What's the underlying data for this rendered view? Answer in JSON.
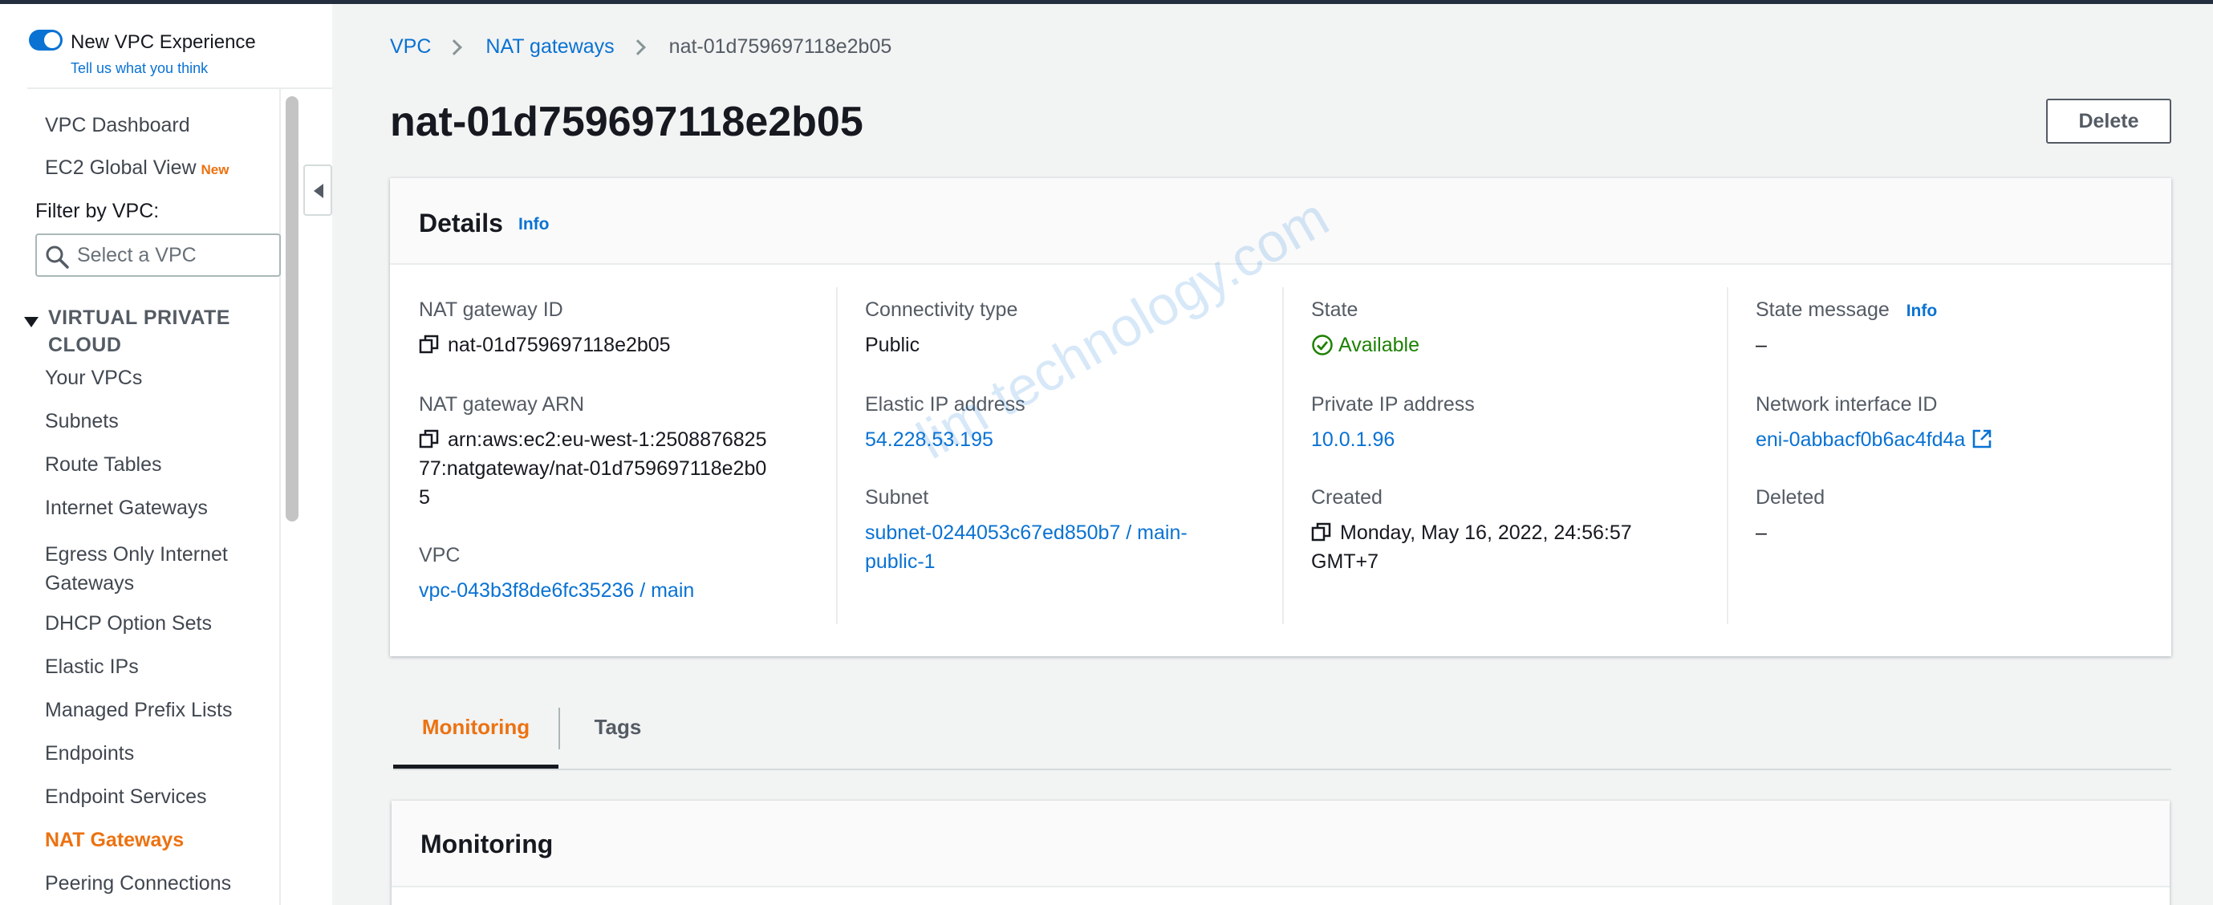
{
  "experience": {
    "title": "New VPC Experience",
    "feedback_link": "Tell us what you think"
  },
  "sidebar": {
    "dashboard": "VPC Dashboard",
    "ec2_global_view": {
      "label": "EC2 Global View",
      "badge": "New"
    },
    "filter_label": "Filter by VPC:",
    "filter_placeholder": "Select a VPC",
    "section_title": "VIRTUAL PRIVATE CLOUD",
    "items": [
      {
        "label": "Your VPCs"
      },
      {
        "label": "Subnets"
      },
      {
        "label": "Route Tables"
      },
      {
        "label": "Internet Gateways"
      },
      {
        "label": "Egress Only Internet Gateways"
      },
      {
        "label": "DHCP Option Sets"
      },
      {
        "label": "Elastic IPs"
      },
      {
        "label": "Managed Prefix Lists"
      },
      {
        "label": "Endpoints"
      },
      {
        "label": "Endpoint Services"
      },
      {
        "label": "NAT Gateways",
        "active": true
      },
      {
        "label": "Peering Connections"
      }
    ]
  },
  "breadcrumb": {
    "root": "VPC",
    "parent": "NAT gateways",
    "current": "nat-01d759697118e2b05"
  },
  "page_title": "nat-01d759697118e2b05",
  "delete_label": "Delete",
  "details": {
    "title": "Details",
    "info": "Info",
    "nat_gateway_id": {
      "label": "NAT gateway ID",
      "value": "nat-01d759697118e2b05"
    },
    "nat_gateway_arn": {
      "label": "NAT gateway ARN",
      "value": "arn:aws:ec2:eu-west-1:250887682577:natgateway/nat-01d759697118e2b05"
    },
    "vpc": {
      "label": "VPC",
      "value": "vpc-043b3f8de6fc35236 / main"
    },
    "connectivity_type": {
      "label": "Connectivity type",
      "value": "Public"
    },
    "elastic_ip": {
      "label": "Elastic IP address",
      "value": "54.228.53.195"
    },
    "subnet": {
      "label": "Subnet",
      "value": "subnet-0244053c67ed850b7 / main-public-1"
    },
    "state": {
      "label": "State",
      "value": "Available"
    },
    "private_ip": {
      "label": "Private IP address",
      "value": "10.0.1.96"
    },
    "created": {
      "label": "Created",
      "value": "Monday, May 16, 2022, 24:56:57 GMT+7"
    },
    "state_message": {
      "label": "State message",
      "info": "Info",
      "value": "–"
    },
    "network_interface": {
      "label": "Network interface ID",
      "value": "eni-0abbacf0b6ac4fd4a"
    },
    "deleted": {
      "label": "Deleted",
      "value": "–"
    }
  },
  "watermark": "lim technology.com",
  "tabs": [
    {
      "label": "Monitoring",
      "active": true
    },
    {
      "label": "Tags"
    }
  ],
  "monitoring": {
    "title": "Monitoring"
  },
  "colors": {
    "link": "#0972d3",
    "accent": "#ec7211",
    "success": "#1d8102",
    "text": "#16191f"
  },
  "icons": [
    "toggle-switch",
    "search-icon",
    "caret-down-icon",
    "chevron-left-icon",
    "chevron-right-icon",
    "copy-icon",
    "check-circle-icon",
    "external-link-icon"
  ]
}
